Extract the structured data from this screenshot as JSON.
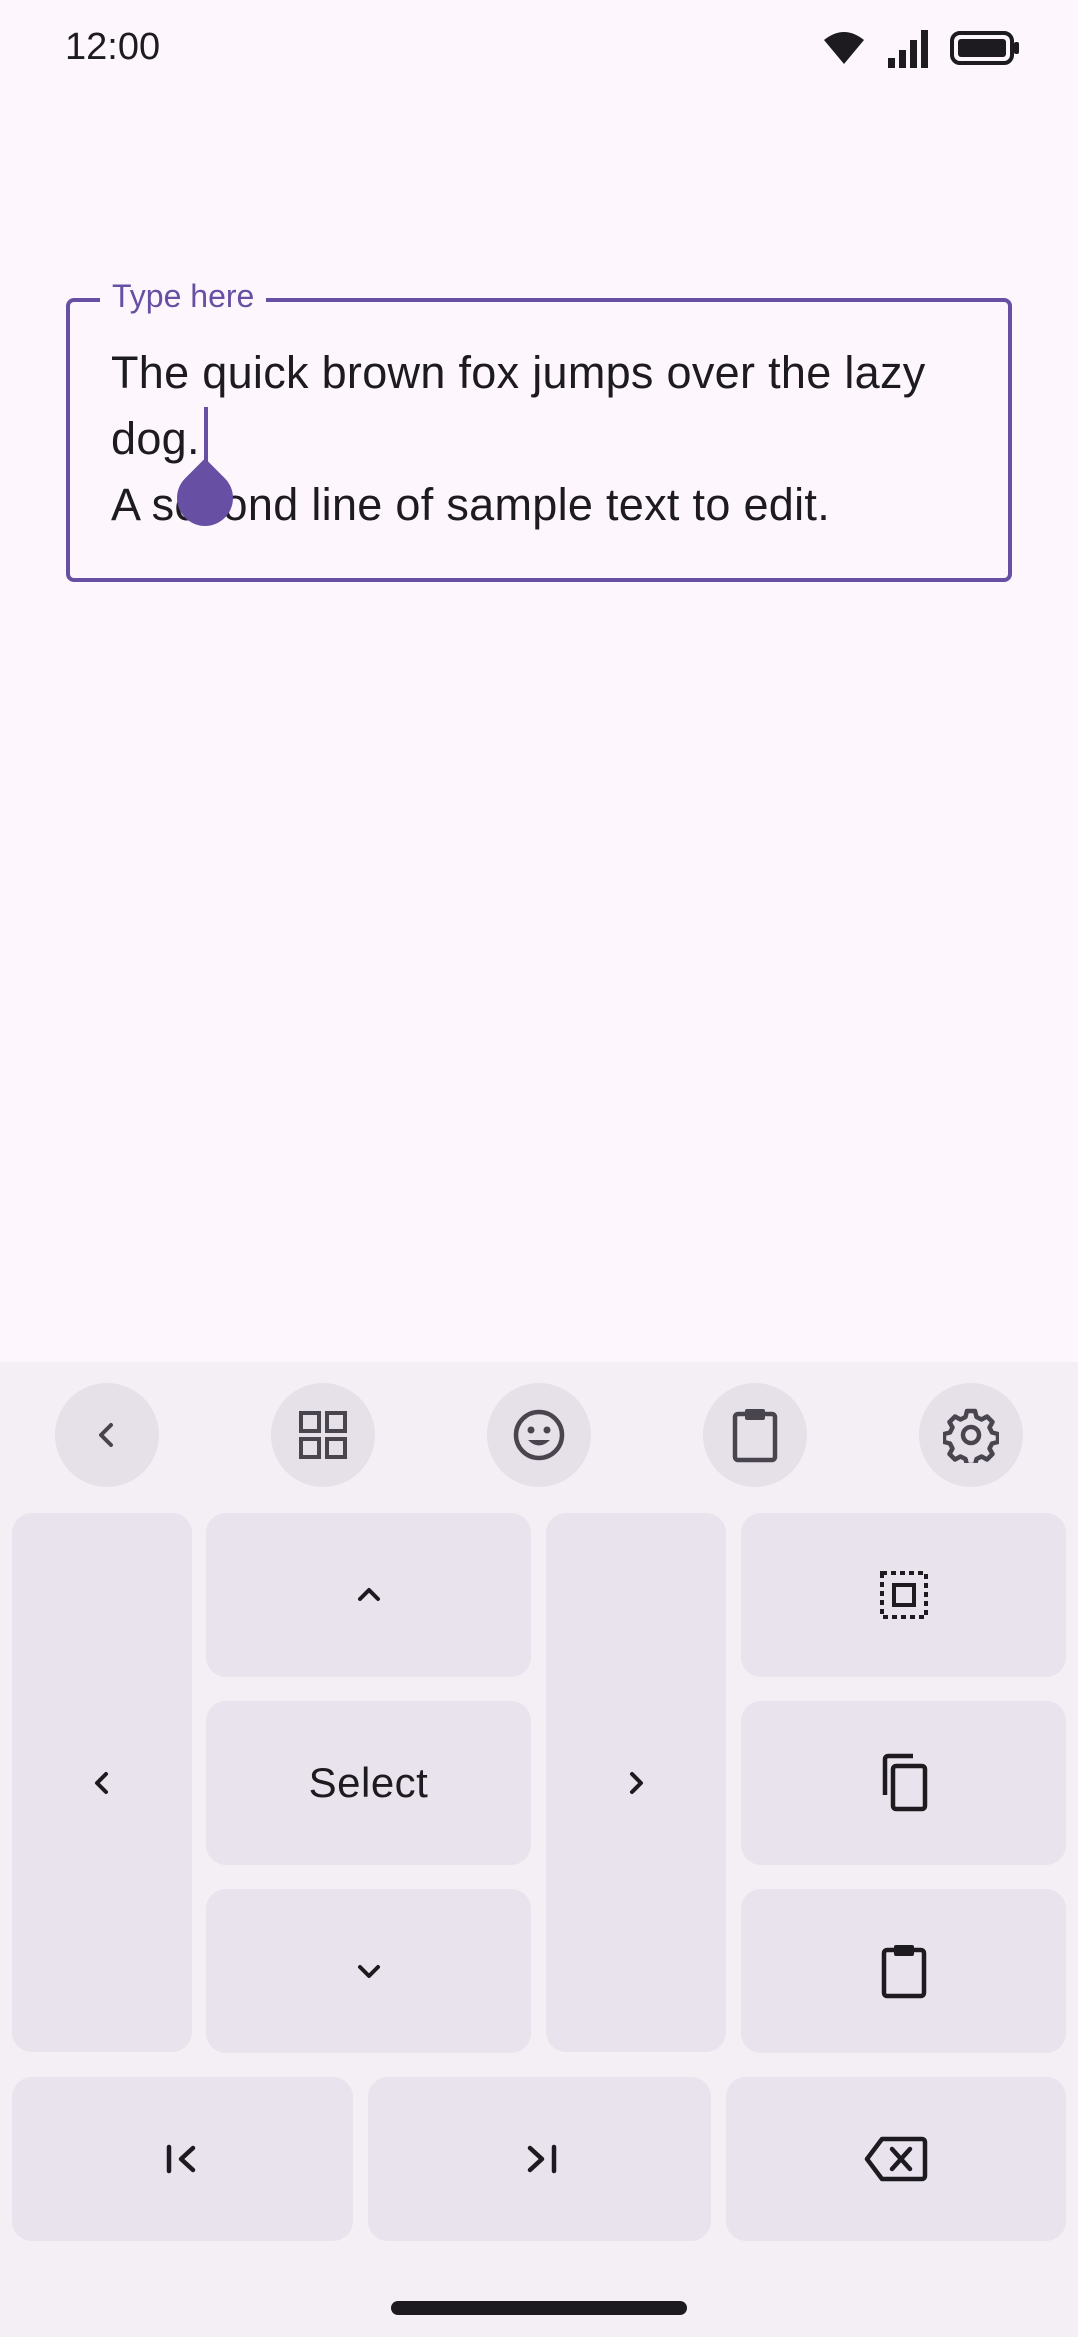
{
  "status_bar": {
    "time": "12:00",
    "icons": [
      "wifi-icon",
      "cellular-signal-icon",
      "battery-icon"
    ]
  },
  "text_field": {
    "label": "Type here",
    "value": "The quick brown fox jumps over the lazy dog.\nA second line of sample text to edit.",
    "line1": "The quick brown fox jumps over the lazy",
    "line2": "dog.",
    "line3": "A second line of sample text to edit."
  },
  "keyboard": {
    "toolbar": [
      {
        "name": "back",
        "icon": "chevron-left-icon"
      },
      {
        "name": "apps",
        "icon": "grid-icon"
      },
      {
        "name": "emoji",
        "icon": "emoji-icon"
      },
      {
        "name": "clipboard",
        "icon": "clipboard-icon"
      },
      {
        "name": "settings",
        "icon": "gear-icon"
      }
    ],
    "select_label": "Select",
    "keys": [
      {
        "name": "left",
        "icon": "chevron-left-icon"
      },
      {
        "name": "up",
        "icon": "chevron-up-icon"
      },
      {
        "name": "select",
        "label": "Select"
      },
      {
        "name": "down",
        "icon": "chevron-down-icon"
      },
      {
        "name": "right",
        "icon": "chevron-right-icon"
      },
      {
        "name": "select-all",
        "icon": "select-all-icon"
      },
      {
        "name": "copy",
        "icon": "copy-icon"
      },
      {
        "name": "paste",
        "icon": "paste-icon"
      },
      {
        "name": "line-start",
        "icon": "move-to-start-icon"
      },
      {
        "name": "line-end",
        "icon": "move-to-end-icon"
      },
      {
        "name": "backspace",
        "icon": "backspace-icon"
      }
    ]
  },
  "colors": {
    "background": "#fdf7fd",
    "accent": "#6750a4",
    "keyboard_bg": "#f4eff4",
    "key_bg": "#e8e3ec",
    "toolbar_btn_bg": "#e6e0e9",
    "text": "#1d1b20"
  }
}
